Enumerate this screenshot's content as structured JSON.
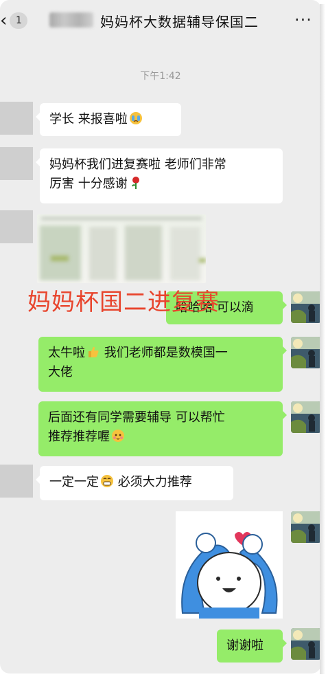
{
  "header": {
    "back_icon": "chevron-left-icon",
    "unread_count": "1",
    "chat_title": "妈妈杯大数据辅导保国二",
    "more_icon": "more-dots-icon"
  },
  "timestamp": "下午1:42",
  "messages": [
    {
      "side": "left",
      "text": "学长 来报喜啦",
      "emoji": "crying-face-emoji"
    },
    {
      "side": "left",
      "line1": "妈妈杯我们进复赛啦  老师们非常",
      "line2": "厉害 十分感谢",
      "emoji": "rose-emoji"
    },
    {
      "side": "left",
      "type": "image",
      "note_icon": "blurred-screenshot-image"
    },
    {
      "side": "right",
      "text": "哈哈哈 可以滴"
    },
    {
      "side": "right",
      "line1": "太牛啦",
      "line1b": " 我们老师都是数模国一",
      "line2": "大佬",
      "emoji": "thumbs-up-emoji"
    },
    {
      "side": "right",
      "line1": "后面还有同学需要辅导 可以帮忙",
      "line2": "推荐推荐喔",
      "emoji": "blush-emoji"
    },
    {
      "side": "left",
      "text_a": "一定一定",
      "text_b": " 必须大力推荐",
      "emoji": "grin-emoji"
    },
    {
      "side": "right",
      "type": "sticker",
      "icon": "heart-pose-sticker"
    },
    {
      "side": "right",
      "text": "谢谢啦"
    }
  ],
  "overlay_caption": "妈妈杯国二进复赛",
  "colors": {
    "background": "#ededed",
    "bubble_right": "#95ec69",
    "bubble_left": "#ffffff",
    "overlay": "#e8442c"
  }
}
